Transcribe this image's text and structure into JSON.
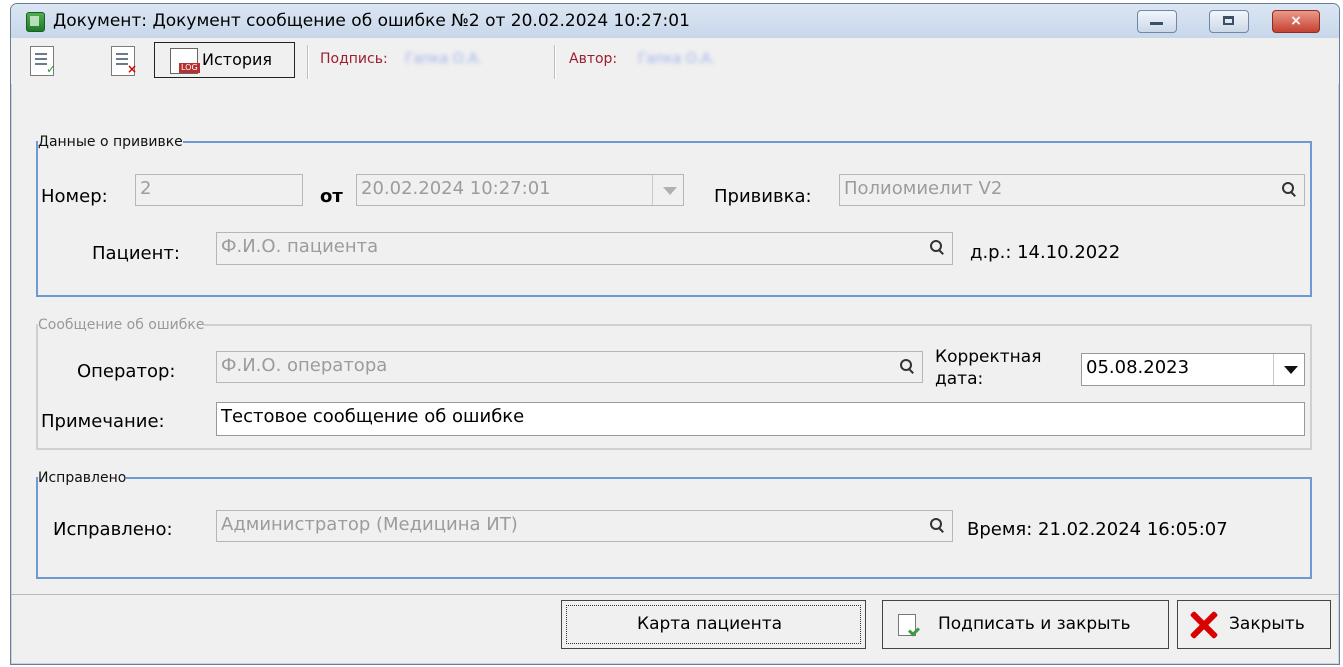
{
  "window": {
    "title": "Документ: Документ сообщение об ошибке №2 от 20.02.2024 10:27:01"
  },
  "toolbar": {
    "history_label": "История",
    "signature_label": "Подпись:",
    "signature_value": "Гапка О.А.",
    "author_label": "Автор:",
    "author_value": "Гапка О.А.",
    "icons": [
      "document-check-icon",
      "document-cancel-icon",
      "log-history-icon"
    ]
  },
  "vaccination": {
    "legend": "Данные о прививке",
    "number_label": "Номер:",
    "number_value": "2",
    "from_label": "от",
    "date_value": "20.02.2024 10:27:01",
    "vaccine_label": "Прививка:",
    "vaccine_value": "Полиомиелит V2",
    "patient_label": "Пациент:",
    "patient_value": "Ф.И.О. пациента",
    "birth_label": "д.р.: 14.10.2022"
  },
  "error_message": {
    "legend": "Сообщение об ошибке",
    "operator_label": "Оператор:",
    "operator_value": "Ф.И.О. оператора",
    "correct_date_label_1": "Корректная",
    "correct_date_label_2": "дата:",
    "correct_date_value": "05.08.2023",
    "note_label": "Примечание:",
    "note_value": "Тестовое сообщение об ошибке"
  },
  "fixed": {
    "legend": "Исправлено",
    "fixed_label": "Исправлено:",
    "fixed_value": "Администратор (Медицина ИТ)",
    "time_label": "Время: 21.02.2024 16:05:07"
  },
  "buttons": {
    "patient_card": "Карта пациента",
    "sign_close": "Подписать и закрыть",
    "close": "Закрыть"
  },
  "colors": {
    "accent_border": "#6d9ad2",
    "red_text": "#9a1f2f",
    "window_bg": "#f0f0f0"
  }
}
